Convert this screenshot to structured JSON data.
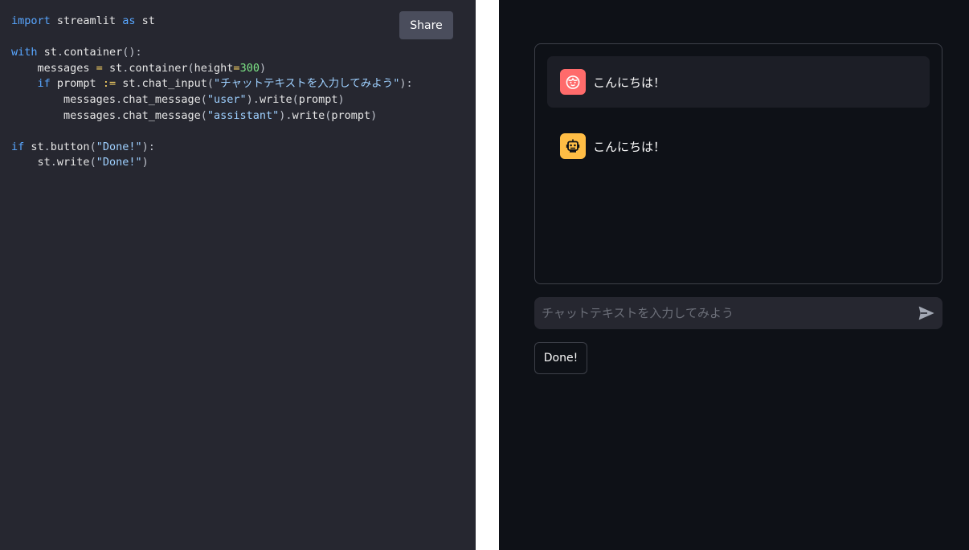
{
  "code_panel": {
    "share_label": "Share",
    "code_lines": [
      "import streamlit as st",
      "",
      "with st.container():",
      "    messages = st.container(height=300)",
      "    if prompt := st.chat_input(\"チャットテキストを入力してみよう\"):",
      "        messages.chat_message(\"user\").write(prompt)",
      "        messages.chat_message(\"assistant\").write(prompt)",
      "",
      "if st.button(\"Done!\"):",
      "    st.write(\"Done!\")"
    ]
  },
  "app": {
    "messages": [
      {
        "role": "user",
        "avatar_icon": "user-face-icon",
        "text": "こんにちは！"
      },
      {
        "role": "assistant",
        "avatar_icon": "robot-icon",
        "text": "こんにちは！"
      }
    ],
    "chat_input": {
      "placeholder": "チャットテキストを入力してみよう",
      "value": "",
      "send_icon": "send-icon"
    },
    "done_button_label": "Done!"
  },
  "colors": {
    "code_bg": "#262730",
    "app_bg": "#0e1117",
    "user_avatar": "#ff6b6b",
    "assistant_avatar": "#ffbd45",
    "keyword": "#58a6ff",
    "string": "#9ed0ff",
    "number": "#7ee787"
  }
}
